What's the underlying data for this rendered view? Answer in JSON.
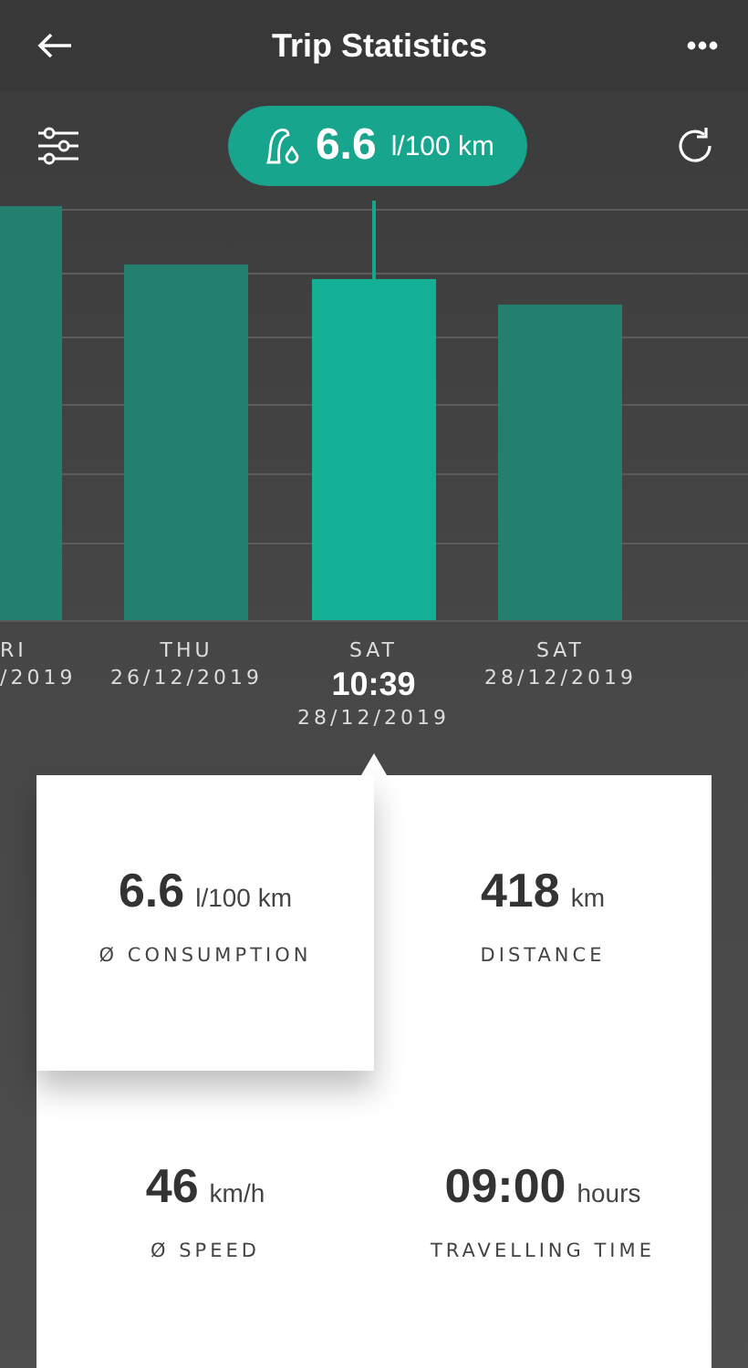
{
  "header": {
    "title": "Trip Statistics"
  },
  "summary": {
    "value": "6.6",
    "unit": "l/100 km"
  },
  "days": [
    {
      "day": "RI",
      "date": "/2019",
      "selected": false
    },
    {
      "day": "THU",
      "date": "26/12/2019",
      "selected": false
    },
    {
      "day": "SAT",
      "time": "10:39",
      "date": "28/12/2019",
      "selected": true
    },
    {
      "day": "SAT",
      "date": "28/12/2019",
      "selected": false
    }
  ],
  "stats": [
    {
      "value": "6.6",
      "unit": "l/100 km",
      "label": "Ø CONSUMPTION",
      "selected": true
    },
    {
      "value": "418",
      "unit": "km",
      "label": "DISTANCE",
      "selected": false
    },
    {
      "value": "46",
      "unit": "km/h",
      "label": "Ø SPEED",
      "selected": false
    },
    {
      "value": "09:00",
      "unit": "hours",
      "label": "TRAVELLING TIME",
      "selected": false
    }
  ]
}
